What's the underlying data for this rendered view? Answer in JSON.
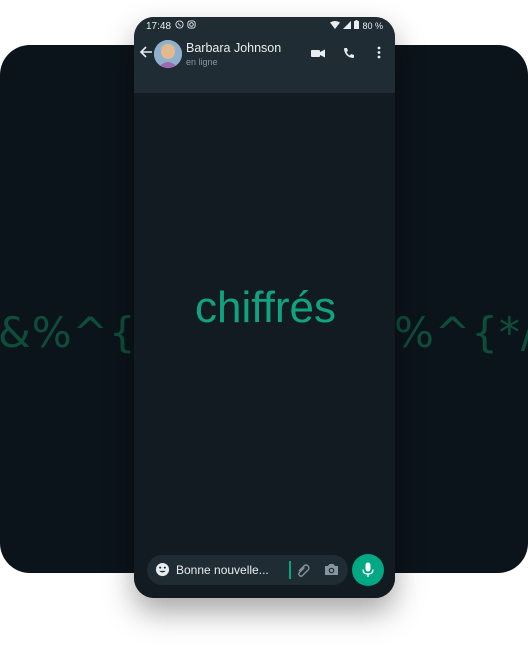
{
  "background": {
    "cipher_left": "&%^{*/",
    "cipher_right": "%^{*/>*&"
  },
  "status_bar": {
    "time": "17:48",
    "battery": "80 %"
  },
  "header": {
    "contact_name": "Barbara Johnson",
    "contact_status": "en ligne"
  },
  "chat": {
    "highlight_word": "chiffrés"
  },
  "composer": {
    "input_value": "Bonne nouvelle..."
  },
  "colors": {
    "accent": "#00a884",
    "header_bg": "#1f2c34",
    "chat_bg": "#121b22",
    "backdrop": "#0b141a"
  },
  "icons": [
    "whatsapp-icon",
    "instagram-icon",
    "wifi-icon",
    "signal-icon",
    "battery-icon",
    "back-arrow-icon",
    "video-call-icon",
    "phone-call-icon",
    "more-vert-icon",
    "emoji-icon",
    "attach-icon",
    "camera-icon",
    "mic-icon"
  ]
}
